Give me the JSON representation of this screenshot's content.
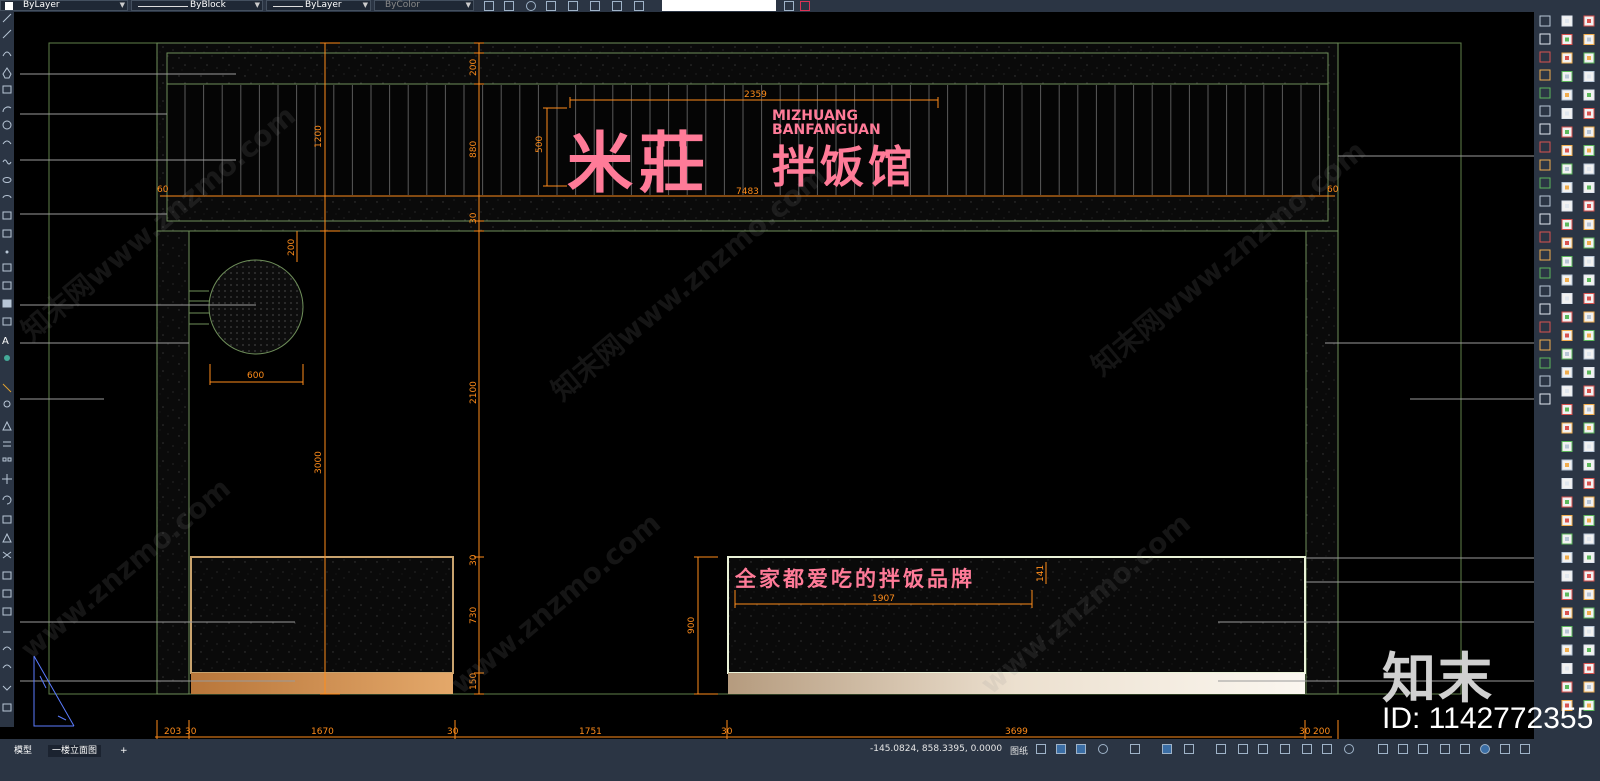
{
  "toolbar": {
    "layer": "ByLayer",
    "linetype": "ByBlock",
    "lineweight": "ByLayer",
    "plotstyle": "ByColor"
  },
  "drawing": {
    "sign_title_cn": "米莊",
    "sign_title_en_1": "MIZHUANG",
    "sign_title_en_2": "BANFANGUAN",
    "sign_subtitle_cn": "拌饭馆",
    "slogan": "全家都爱吃的拌饭品牌",
    "dims": {
      "sign_width": "2359",
      "sign_height": "500",
      "fascia_width": "7483",
      "top_band": "200",
      "fascia_height": "880",
      "upper_total": "1200",
      "left_60": "60",
      "right_60": "60",
      "circle_200": "200",
      "circle_diam": "600",
      "door_2100": "2100",
      "total_3000": "3000",
      "ledge_30": "30",
      "window_730": "730",
      "base_150": "150",
      "counter_900": "900",
      "slogan_width": "1907",
      "slogan_height": "141",
      "b_203": "203",
      "b_30a": "30",
      "b_1670": "1670",
      "b_30b": "30",
      "b_1751": "1751",
      "b_30c": "30",
      "b_3699": "3699",
      "b_30d": "30",
      "b_200": "200",
      "c_30": "30"
    }
  },
  "watermarks": [
    "知末网www.znzmo.com",
    "知末网www.znzmo.com",
    "知末网www.znzmo.com",
    "www.znzmo.com",
    "www.znzmo.com",
    "www.znzmo.com"
  ],
  "logo": "知末",
  "id_text": "ID: 1142772355",
  "status": {
    "tab_model": "模型",
    "tab_layout": "一楼立面图",
    "tab_add": "+",
    "coords": "-145.0824, 858.3395, 0.0000",
    "space": "图纸"
  },
  "colors": {
    "dim": "#ff8c1a",
    "sign": "#ff7b98",
    "outline": "#6f8f5a",
    "ui_bg": "#2b3544"
  }
}
